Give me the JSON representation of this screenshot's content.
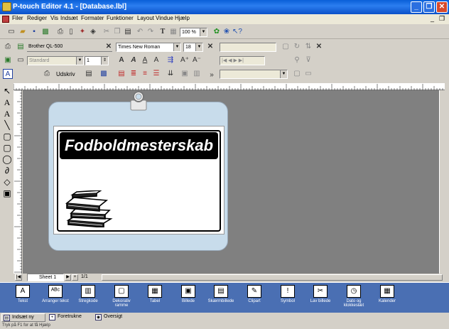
{
  "window": {
    "title": "P-touch Editor 4.1 - [Database.lbl]",
    "minimize": "_",
    "restore": "❐",
    "close": "✕"
  },
  "menu": {
    "items": [
      "Filer",
      "Rediger",
      "Vis",
      "Indsæt",
      "Formater",
      "Funktioner",
      "Layout",
      "Vindue",
      "Hjælp"
    ]
  },
  "toolbar": {
    "zoom": "100 %",
    "printer": "Brother QL-500",
    "font": "Times New Roman",
    "font_size": "18",
    "layout": "Standard",
    "copies": "1",
    "print_label": "Udskriv"
  },
  "sheet": {
    "tab": "Sheet 1",
    "pages": "1/1"
  },
  "label": {
    "title": "Fodboldmesterskab"
  },
  "palette": {
    "items": [
      {
        "label": "Tekst",
        "icon": "A"
      },
      {
        "label": "Arranger tekst",
        "icon": "ᴬᴮᶜ"
      },
      {
        "label": "Stregkode",
        "icon": "▥"
      },
      {
        "label": "Dekorativ ramme",
        "icon": "▢"
      },
      {
        "label": "Tabel",
        "icon": "▦"
      },
      {
        "label": "Billede",
        "icon": "▣"
      },
      {
        "label": "Skærmbillede",
        "icon": "▤"
      },
      {
        "label": "Clipart",
        "icon": "✎"
      },
      {
        "label": "Symbol",
        "icon": "!"
      },
      {
        "label": "Lav billede",
        "icon": "✂"
      },
      {
        "label": "Dato og klokkeslæt",
        "icon": "◷"
      },
      {
        "label": "Kalender",
        "icon": "▦"
      }
    ]
  },
  "status_tabs": {
    "insert": "Indsæt ny",
    "format": "Foretrukne",
    "overview": "Oversigt"
  },
  "status": {
    "text": "Tryk på F1 for at få Hjælp"
  }
}
